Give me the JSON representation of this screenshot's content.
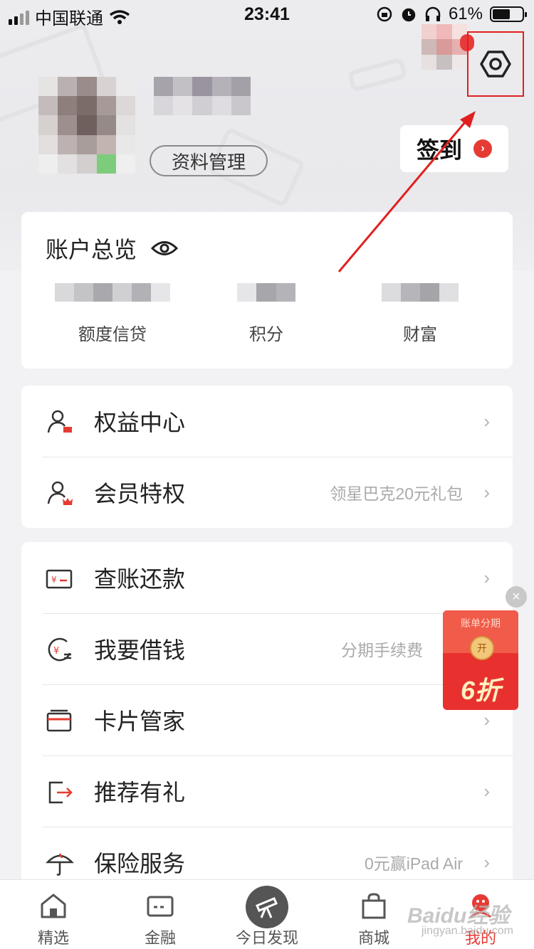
{
  "status_bar": {
    "carrier": "中国联通",
    "time": "23:41",
    "battery": "61%",
    "battery_level": 0.61
  },
  "profile": {
    "manage_button": "资料管理",
    "signin_button": "签到"
  },
  "overview": {
    "title": "账户总览",
    "columns": [
      {
        "label": "额度信贷"
      },
      {
        "label": "积分"
      },
      {
        "label": "财富"
      }
    ]
  },
  "menu_group_1": [
    {
      "label": "权益中心",
      "sub": "",
      "icon": "user-card-icon"
    },
    {
      "label": "会员特权",
      "sub": "领星巴克20元礼包",
      "icon": "user-crown-icon"
    }
  ],
  "menu_group_2": [
    {
      "label": "查账还款",
      "sub": "",
      "icon": "bill-card-icon"
    },
    {
      "label": "我要借钱",
      "sub": "分期手续费",
      "icon": "loan-icon"
    },
    {
      "label": "卡片管家",
      "sub": "",
      "icon": "card-icon"
    },
    {
      "label": "推荐有礼",
      "sub": "",
      "icon": "share-exit-icon"
    },
    {
      "label": "保险服务",
      "sub": "0元赢iPad Air",
      "icon": "umbrella-icon"
    }
  ],
  "promo": {
    "title": "账单分期",
    "coin": "开",
    "discount": "6折"
  },
  "tabs": [
    {
      "label": "精选",
      "icon": "home-icon"
    },
    {
      "label": "金融",
      "icon": "card-tab-icon"
    },
    {
      "label": "今日发现",
      "icon": "telescope-icon"
    },
    {
      "label": "商城",
      "icon": "bag-icon"
    },
    {
      "label": "我的",
      "icon": "mine-icon",
      "active": true
    }
  ],
  "watermark": {
    "main": "Baidu经验",
    "sub": "jingyan.baidu.com"
  },
  "colors": {
    "accent": "#e63b34",
    "highlight_box": "#e02020"
  }
}
